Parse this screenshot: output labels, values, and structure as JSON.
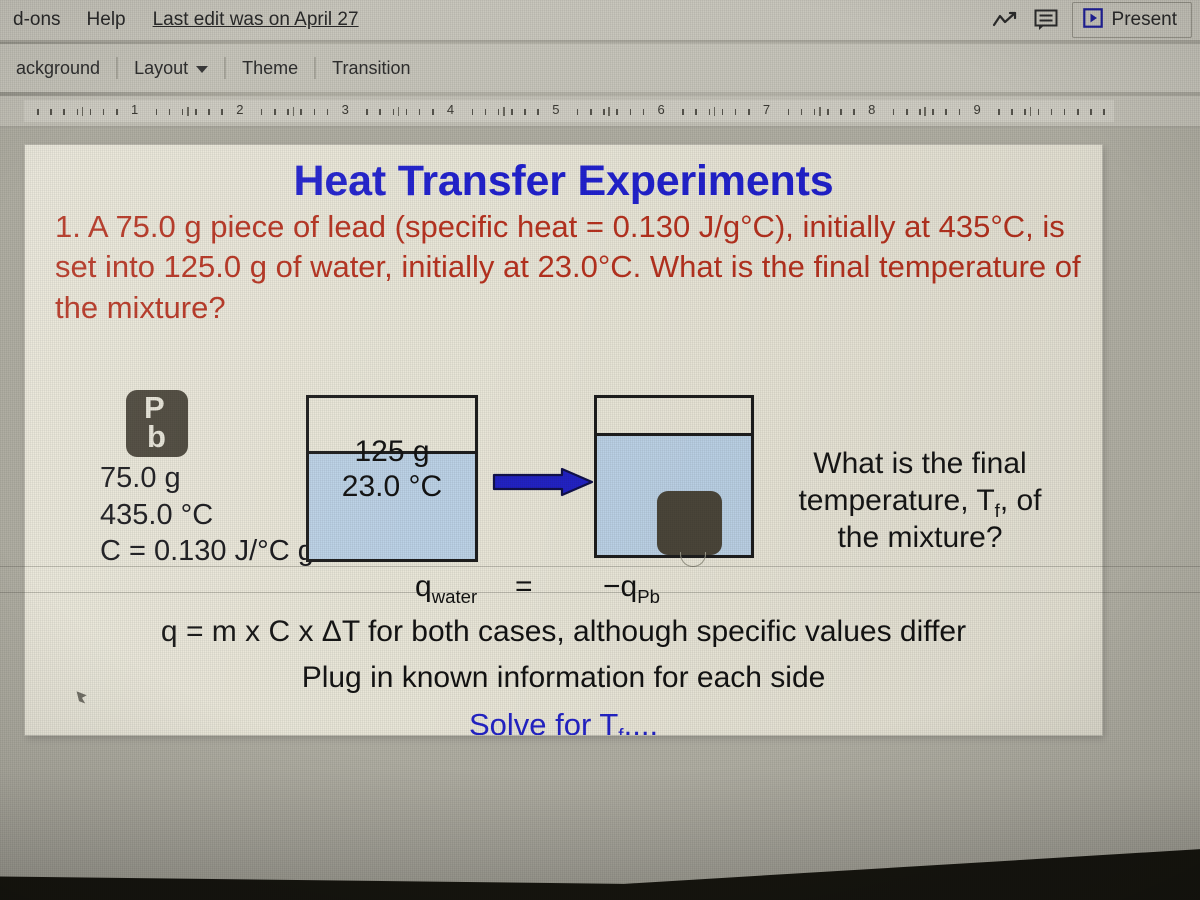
{
  "app": {
    "menubar": {
      "items": [
        "d-ons",
        "Help"
      ],
      "last_edit": "Last edit was on April 27",
      "right_icons": [
        "activity-chart-icon",
        "comment-icon"
      ],
      "present_label": "Present",
      "present_icon": "play-icon"
    },
    "toolbar": {
      "items": [
        {
          "label": "ackground",
          "has_caret": false
        },
        {
          "label": "Layout",
          "has_caret": true
        },
        {
          "label": "Theme",
          "has_caret": false
        },
        {
          "label": "Transition",
          "has_caret": false
        }
      ]
    },
    "ruler": {
      "numbers": [
        "1",
        "2",
        "3",
        "4",
        "5",
        "6",
        "7",
        "8",
        "9"
      ]
    }
  },
  "slide": {
    "title": "Heat Transfer Experiments",
    "problem_number": "1.",
    "problem_text": "A 75.0 g piece of lead (specific heat = 0.130 J/g°C), initially at 435°C, is set into 125.0 g of water, initially at 23.0°C. What is the final temperature of the mixture?",
    "lead_sample": {
      "symbol_top": "P",
      "symbol_bottom": "b",
      "mass": "75.0 g",
      "temperature": "435.0 °C",
      "specific_heat": "C = 0.130 J/°C g"
    },
    "beaker_initial": {
      "mass": "125  g",
      "temperature": "23.0 °C"
    },
    "beaker_final": {
      "contains_lead": true
    },
    "arrow": {
      "direction": "right",
      "color": "#2222c4"
    },
    "right_question_line1": "What is the final",
    "right_question_line2_a": "temperature, T",
    "right_question_line2_sub": "f",
    "right_question_line2_b": ", of",
    "right_question_line3": "the mixture?",
    "equation": {
      "left_symbol": "q",
      "left_subscript": "water",
      "operator": "=",
      "right_symbol": "−q",
      "right_subscript": "Pb"
    },
    "line_q_formula": "q = m x C x ΔT for both cases, although specific values differ",
    "line_plug": "Plug in known information for each side",
    "line_solve_a": "Solve for T",
    "line_solve_sub": "f",
    "line_solve_b": "...."
  },
  "colors": {
    "title_blue": "#2121cf",
    "problem_red": "#b8321f",
    "slide_bg": "#e9e6d8",
    "water_blue": "#bcd2e6",
    "lead_brown": "#4b463a",
    "arrow_blue": "#2222c4",
    "solve_blue": "#2323c8"
  }
}
